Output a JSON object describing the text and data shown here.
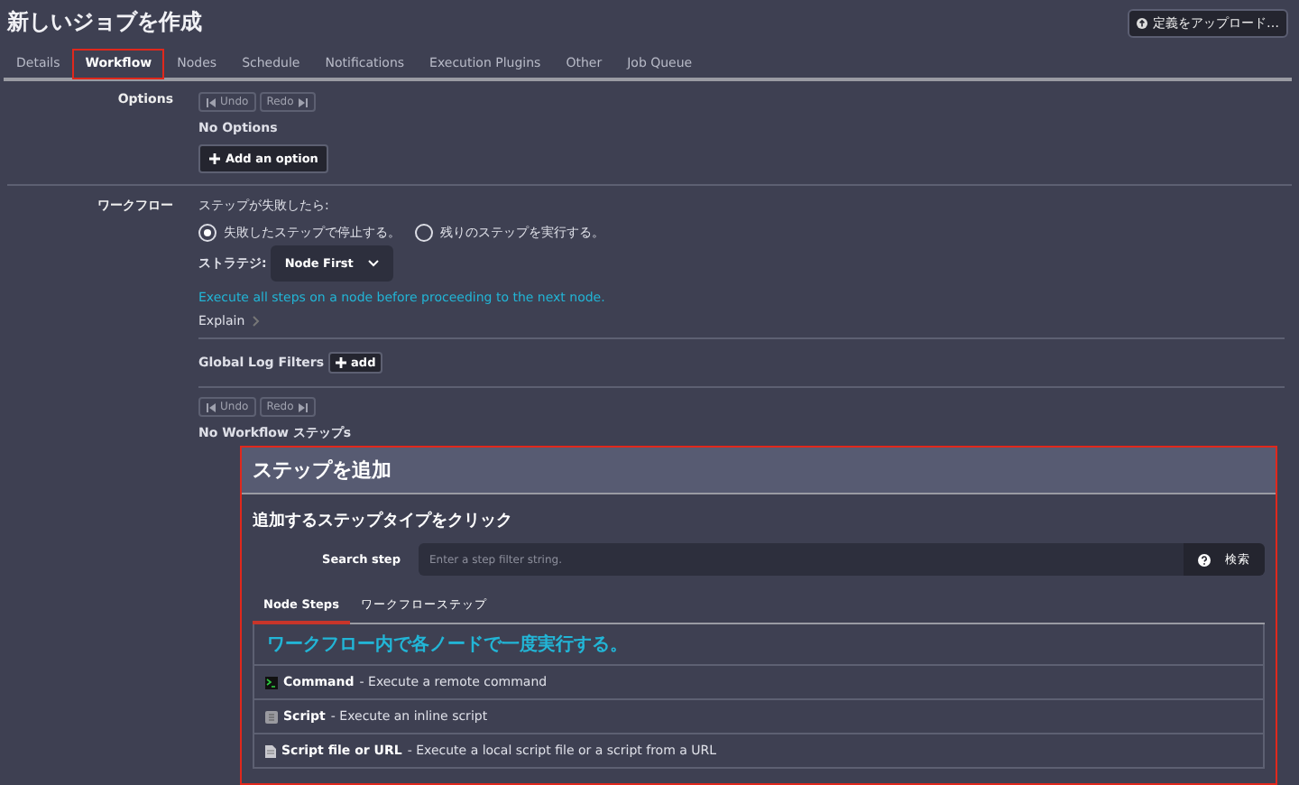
{
  "title": "新しいジョブを作成",
  "upload_button": "定義をアップロード…",
  "tabs": [
    {
      "label": "Details",
      "selected": false,
      "highlighted": false
    },
    {
      "label": "Workflow",
      "selected": true,
      "highlighted": true
    },
    {
      "label": "Nodes",
      "selected": false,
      "highlighted": false
    },
    {
      "label": "Schedule",
      "selected": false,
      "highlighted": false
    },
    {
      "label": "Notifications",
      "selected": false,
      "highlighted": false
    },
    {
      "label": "Execution Plugins",
      "selected": false,
      "highlighted": false
    },
    {
      "label": "Other",
      "selected": false,
      "highlighted": false
    },
    {
      "label": "Job Queue",
      "selected": false,
      "highlighted": false
    }
  ],
  "options": {
    "label": "Options",
    "undo": "Undo",
    "redo": "Redo",
    "empty": "No Options",
    "add_button": "Add an option"
  },
  "workflow": {
    "label": "ワークフロー",
    "on_failure_label": "ステップが失敗したら:",
    "radios": [
      {
        "label": "失敗したステップで停止する。",
        "selected": true
      },
      {
        "label": "残りのステップを実行する。",
        "selected": false
      }
    ],
    "strategy_label": "ストラテジ:",
    "strategy": "Node First",
    "strategy_description": "Execute all steps on a node before proceeding to the next node.",
    "explain": "Explain",
    "log_filters_label": "Global Log Filters",
    "log_filters_add": "add",
    "undo": "Undo",
    "redo": "Redo",
    "empty": "No Workflow ステップs"
  },
  "add_step": {
    "title": "ステップを追加",
    "highlighted": true,
    "subtitle": "追加するステップタイプをクリック",
    "search_label": "Search step",
    "search_placeholder": "Enter a step filter string.",
    "search_button": "検索",
    "tabs": [
      {
        "label": "Node Steps",
        "selected": true
      },
      {
        "label": "ワークフローステップ",
        "selected": false
      }
    ],
    "section_heading": "ワークフロー内で各ノードで一度実行する。",
    "steps": [
      {
        "kind": "command",
        "name": "Command",
        "description": "- Execute a remote command"
      },
      {
        "kind": "script",
        "name": "Script",
        "description": "- Execute an inline script"
      },
      {
        "kind": "file",
        "name": "Script file or URL",
        "description": "- Execute a local script file or a script from a URL"
      }
    ]
  }
}
